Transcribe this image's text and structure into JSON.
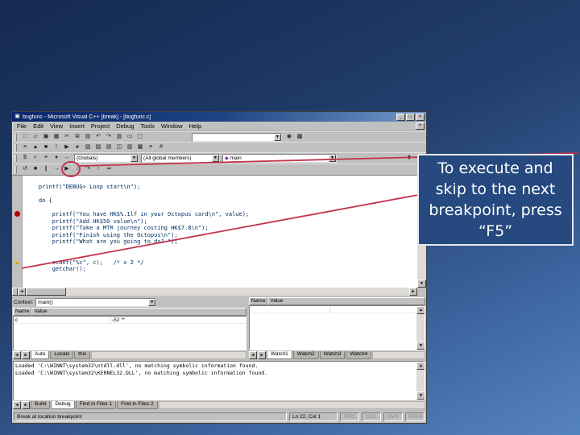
{
  "colors": {
    "annotation_red": "#c2344c",
    "callout_bg": "#26497f",
    "callout_border": "#e6e9f2",
    "code_text": "#003060",
    "breakpoint_red": "#b00000",
    "current_line_yellow": "#f2cc0c",
    "titlebar_start": "#0a246a",
    "titlebar_end": "#7197c8",
    "slide_bg_top": "#14294f",
    "slide_bg_bottom": "#5583bf"
  },
  "callout": {
    "lines": [
      "To execute and",
      "skip to the next",
      "breakpoint, press",
      "“F5”"
    ]
  },
  "ide": {
    "title": "bugfunc - Microsoft Visual C++ [break] - [bugfunc.c]",
    "glyphs": {
      "app_icon": "▣",
      "mdi_close": "×",
      "combo_arrow": "▼",
      "scroll_up": "▲",
      "scroll_down": "▼",
      "scroll_left": "◄",
      "scroll_right": "►",
      "current_arrow": "►",
      "function_diamond": "◆"
    },
    "window_controls": [
      {
        "name": "minimize-button",
        "glyph": "_"
      },
      {
        "name": "maximize-button",
        "glyph": "□"
      },
      {
        "name": "close-button",
        "glyph": "×"
      }
    ],
    "menu": [
      "File",
      "Edit",
      "View",
      "Insert",
      "Project",
      "Debug",
      "Tools",
      "Window",
      "Help"
    ],
    "toolbar_main": [
      {
        "name": "new-file-icon",
        "glyph": "□"
      },
      {
        "name": "open-file-icon",
        "glyph": "▱"
      },
      {
        "name": "save-icon",
        "glyph": "▣"
      },
      {
        "name": "save-all-icon",
        "glyph": "▦"
      },
      {
        "name": "cut-icon",
        "glyph": "✂"
      },
      {
        "name": "copy-icon",
        "glyph": "⧉"
      },
      {
        "name": "paste-icon",
        "glyph": "▤"
      },
      {
        "name": "undo-icon",
        "glyph": "↶"
      },
      {
        "name": "redo-icon",
        "glyph": "↷"
      },
      {
        "name": "workspace-icon",
        "glyph": "▥"
      },
      {
        "name": "output-window-icon",
        "glyph": "▭"
      },
      {
        "name": "window-list-icon",
        "glyph": "▢"
      }
    ],
    "find_combo_value": "",
    "toolbar_main_right": [
      {
        "name": "search-icon",
        "glyph": "◉"
      },
      {
        "name": "find-in-files-icon",
        "glyph": "▩"
      }
    ],
    "toolbar_build": [
      {
        "name": "compile-icon",
        "glyph": "≡"
      },
      {
        "name": "build-icon",
        "glyph": "▲"
      },
      {
        "name": "stop-build-icon",
        "glyph": "■"
      },
      {
        "name": "execute-program-icon",
        "glyph": "!"
      },
      {
        "name": "go-icon",
        "glyph": "▶"
      },
      {
        "name": "insert-breakpoint-icon",
        "glyph": "●"
      },
      {
        "name": "workspace-pane-icon",
        "glyph": "▧"
      },
      {
        "name": "output-pane-icon",
        "glyph": "▨"
      },
      {
        "name": "variables-pane-icon",
        "glyph": "▤"
      },
      {
        "name": "watch-pane-icon",
        "glyph": "◫"
      },
      {
        "name": "registers-pane-icon",
        "glyph": "▥"
      },
      {
        "name": "memory-pane-icon",
        "glyph": "▦"
      },
      {
        "name": "call-stack-icon",
        "glyph": "≡"
      },
      {
        "name": "disassembly-icon",
        "glyph": "#"
      }
    ],
    "wizardbar": {
      "icons": [
        {
          "name": "members-filter-icon",
          "glyph": "$"
        },
        {
          "name": "goto-definition-icon",
          "glyph": "✓"
        },
        {
          "name": "wizard-menu-icon",
          "glyph": "≡"
        },
        {
          "name": "class-view-icon",
          "glyph": "♦"
        },
        {
          "name": "next-member-icon",
          "glyph": "↔"
        }
      ],
      "class_combo": "(Globals)",
      "members_combo": "(All global members)",
      "function_combo": "main",
      "right_icons": [
        {
          "name": "wizard-go-icon",
          "glyph": "◆"
        },
        {
          "name": "wizard-actions-icon",
          "glyph": "▾"
        }
      ]
    },
    "debugbar": [
      {
        "name": "restart-icon",
        "glyph": "↺"
      },
      {
        "name": "stop-debugging-icon",
        "glyph": "■"
      },
      {
        "name": "break-execution-icon",
        "glyph": "∥"
      },
      {
        "name": "show-next-statement-icon",
        "glyph": "→"
      },
      {
        "name": "go-button",
        "glyph": "▶"
      },
      {
        "name": "step-into-icon",
        "glyph": "↓"
      },
      {
        "name": "step-over-icon",
        "glyph": "↷"
      },
      {
        "name": "step-out-icon",
        "glyph": "↑"
      },
      {
        "name": "run-to-cursor-icon",
        "glyph": "⇒"
      }
    ],
    "editor": {
      "code_lines": [
        "    printf(\"DEBUG> Loop start\\n\");",
        "",
        "    do {",
        "",
        "        printf(\"You have HK$%.1lf in your Octopus card\\n\", value);",
        "        printf(\"Add HK$50 value\\n\");",
        "        printf(\"Take a MTR journey costing HK$7.8\\n\");",
        "        printf(\"Finish using the Octopus\\n\");",
        "        printf(\"What are you going to do? \");",
        "",
        "",
        "        scanf(\"%c\", c);   /* x 2 */",
        "        getchar();"
      ],
      "breakpoint_line": 4,
      "current_line": 11
    },
    "variables_pane": {
      "context_label": "Context:",
      "context_value": "main()",
      "columns": [
        "Name",
        "Value"
      ],
      "rows": [
        {
          "var": "c",
          "value": "-52 '*'"
        }
      ],
      "tabs": [
        {
          "label": "Auto",
          "active": true
        },
        {
          "label": "Locals"
        },
        {
          "label": "this"
        }
      ]
    },
    "watch_pane": {
      "columns": [
        "Name",
        "Value"
      ],
      "rows": [
        {
          "var": "",
          "value": ""
        }
      ],
      "tabs": [
        {
          "label": "Watch1",
          "active": true
        },
        {
          "label": "Watch2"
        },
        {
          "label": "Watch3"
        },
        {
          "label": "Watch4"
        }
      ]
    },
    "output_pane": {
      "lines": [
        "Loaded 'C:\\WINNT\\system32\\ntdll.dll', no matching symbolic information found.",
        "Loaded 'C:\\WINNT\\system32\\KERNEL32.DLL', no matching symbolic information found."
      ],
      "tabs": [
        {
          "label": "Build"
        },
        {
          "label": "Debug",
          "active": true
        },
        {
          "label": "Find in Files 1"
        },
        {
          "label": "Find in Files 2"
        }
      ]
    },
    "status_bar": {
      "message": "Break at location breakpoint",
      "position": "Ln 22, Col 1",
      "indicators": [
        "REC",
        "COL",
        "OVR",
        "READ"
      ]
    }
  }
}
